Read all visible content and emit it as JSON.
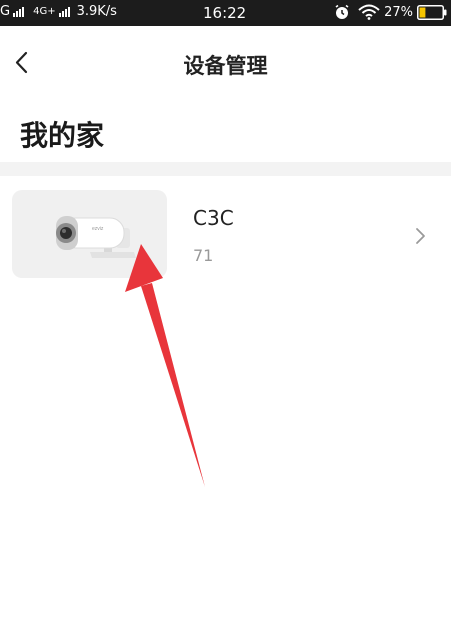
{
  "status_bar": {
    "carrier1": "G",
    "carrier2": "4G+",
    "speed": "3.9K/s",
    "time": "16:22",
    "battery": "27%",
    "battery_level": 0.27,
    "battery_color": "#f5c400"
  },
  "nav": {
    "title": "设备管理",
    "back_icon": "chevron-left-icon"
  },
  "home": {
    "title": "我的家"
  },
  "devices": [
    {
      "name": "C3C",
      "sub": "71",
      "icon": "camera-icon"
    }
  ],
  "annotation": {
    "color": "#e8353b"
  }
}
